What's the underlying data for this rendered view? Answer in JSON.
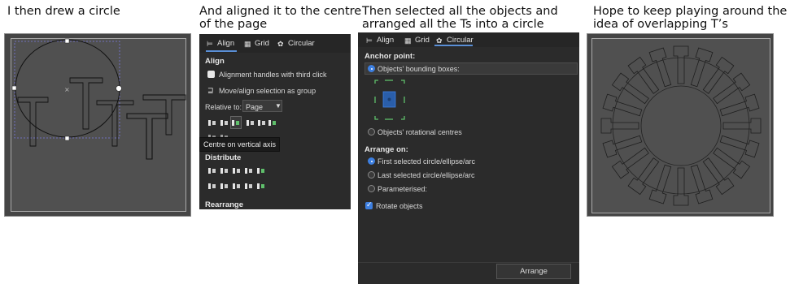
{
  "captions": {
    "c1": "I then drew a circle",
    "c2_line1": "And aligned it to the centre",
    "c2_line2": "of the page",
    "c3_line1": "Then selected all the objects and",
    "c3_line2": "arranged all the Ts into a circle",
    "c4_line1": "Hope to keep playing around the",
    "c4_line2": "idea of overlapping T’s"
  },
  "align_panel": {
    "tabs": [
      {
        "label": "Align",
        "icon": "align-icon"
      },
      {
        "label": "Grid",
        "icon": "grid-icon"
      },
      {
        "label": "Circular",
        "icon": "circular-icon"
      }
    ],
    "align_heading": "Align",
    "alignment_handles_label": "Alignment handles with third click",
    "move_group_label": "Move/align selection as group",
    "relative_to_label": "Relative to:",
    "relative_to_value": "Page",
    "tooltip": "Centre on vertical axis",
    "distribute_heading": "Distribute",
    "rearrange_heading": "Rearrange"
  },
  "circular_panel": {
    "tabs": [
      {
        "label": "Align",
        "icon": "align-icon"
      },
      {
        "label": "Grid",
        "icon": "grid-icon"
      },
      {
        "label": "Circular",
        "icon": "circular-icon"
      }
    ],
    "anchor_heading": "Anchor point:",
    "bbox_option": "Objects' bounding boxes:",
    "rotational_option": "Objects' rotational centres",
    "arrange_on_heading": "Arrange on:",
    "first_selected": "First selected circle/ellipse/arc",
    "last_selected": "Last selected circle/ellipse/arc",
    "parameterised": "Parameterised:",
    "rotate_objects": "Rotate objects",
    "arrange_button": "Arrange"
  },
  "colors": {
    "accent": "#3d7fe0",
    "dialog_bg": "#2b2b2b",
    "canvas_bg": "#454545",
    "handle_green": "#5fbf6b"
  }
}
